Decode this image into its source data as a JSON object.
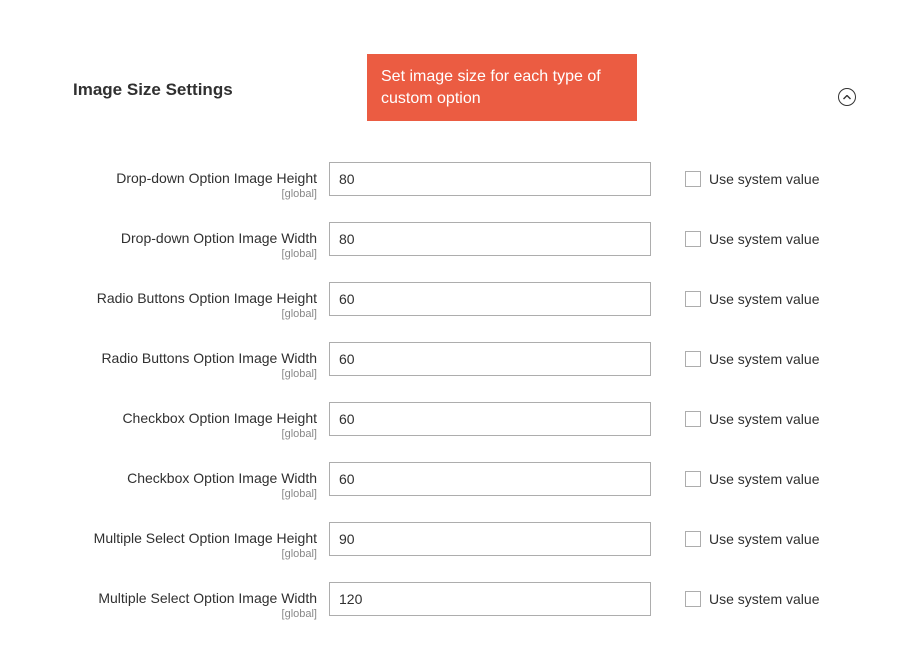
{
  "section_title": "Image Size Settings",
  "banner_text": "Set image size for each type of custom option",
  "scope_label": "[global]",
  "use_system_label": "Use system value",
  "fields": [
    {
      "label": "Drop-down Option Image Height",
      "value": "80",
      "use_system": false
    },
    {
      "label": "Drop-down Option Image Width",
      "value": "80",
      "use_system": false
    },
    {
      "label": "Radio Buttons Option Image Height",
      "value": "60",
      "use_system": false
    },
    {
      "label": "Radio Buttons Option Image Width",
      "value": "60",
      "use_system": false
    },
    {
      "label": "Checkbox Option Image Height",
      "value": "60",
      "use_system": false
    },
    {
      "label": "Checkbox Option Image Width",
      "value": "60",
      "use_system": false
    },
    {
      "label": "Multiple Select Option Image Height",
      "value": "90",
      "use_system": false
    },
    {
      "label": "Multiple Select Option Image Width",
      "value": "120",
      "use_system": false
    }
  ]
}
